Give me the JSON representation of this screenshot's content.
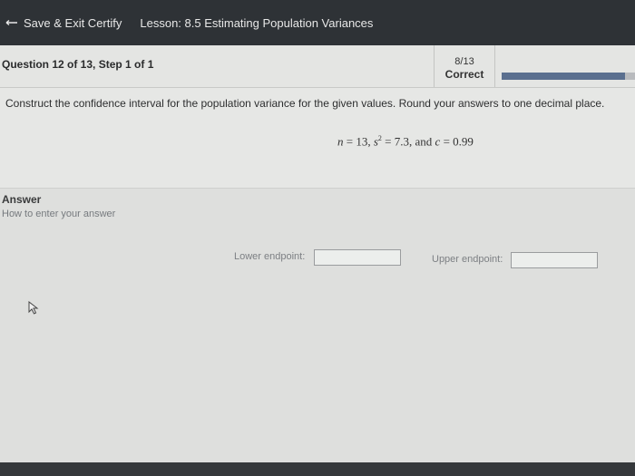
{
  "header": {
    "back_label": "Save & Exit Certify",
    "lesson_title": "Lesson: 8.5 Estimating Population Variances"
  },
  "question": {
    "title": "Question 12 of 13, Step 1 of 1",
    "score": "8/13",
    "status": "Correct",
    "progress_fraction": 0.923
  },
  "problem": {
    "instructions": "Construct the confidence interval for the population variance for the given values. Round your answers to one decimal place.",
    "given": {
      "n_label": "n",
      "n_value": "13",
      "s_label": "s",
      "s_exp": "2",
      "s_value": "7.3",
      "and_text": "and",
      "c_label": "c",
      "c_value": "0.99"
    }
  },
  "answer": {
    "label": "Answer",
    "help_link": "How to enter your answer",
    "lower_label": "Lower endpoint:",
    "upper_label": "Upper endpoint:",
    "lower_value": "",
    "upper_value": ""
  },
  "colors": {
    "topbar": "#2e3236",
    "progress_fill": "#5a6f8f"
  }
}
